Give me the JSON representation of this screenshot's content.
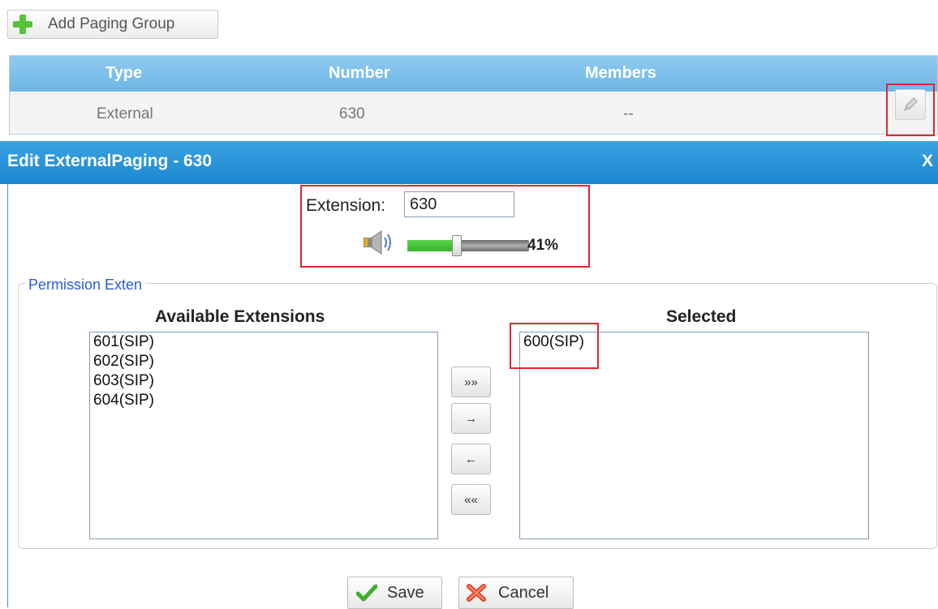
{
  "toolbar": {
    "add_label": "Add Paging Group"
  },
  "table": {
    "headers": [
      "Type",
      "Number",
      "Members"
    ],
    "rows": [
      {
        "type": "External",
        "number": "630",
        "members": "--"
      }
    ]
  },
  "dialog": {
    "title": "Edit ExternalPaging - 630",
    "close_label": "X",
    "extension_label": "Extension:",
    "extension_value": "630",
    "volume": {
      "percent": 41,
      "percent_label": "41%"
    },
    "permission_legend": "Permission Exten",
    "available_title": "Available Extensions",
    "selected_title": "Selected",
    "available": [
      "601(SIP)",
      "602(SIP)",
      "603(SIP)",
      "604(SIP)"
    ],
    "selected": [
      "600(SIP)"
    ],
    "move_buttons": [
      "»»",
      "→",
      "←",
      "««"
    ],
    "save_label": "Save",
    "cancel_label": "Cancel"
  },
  "colors": {
    "header": "#6db7e8",
    "dialog_title": "#1b86cf",
    "accent_green": "#36b52a",
    "highlight_red": "#e0262e"
  }
}
